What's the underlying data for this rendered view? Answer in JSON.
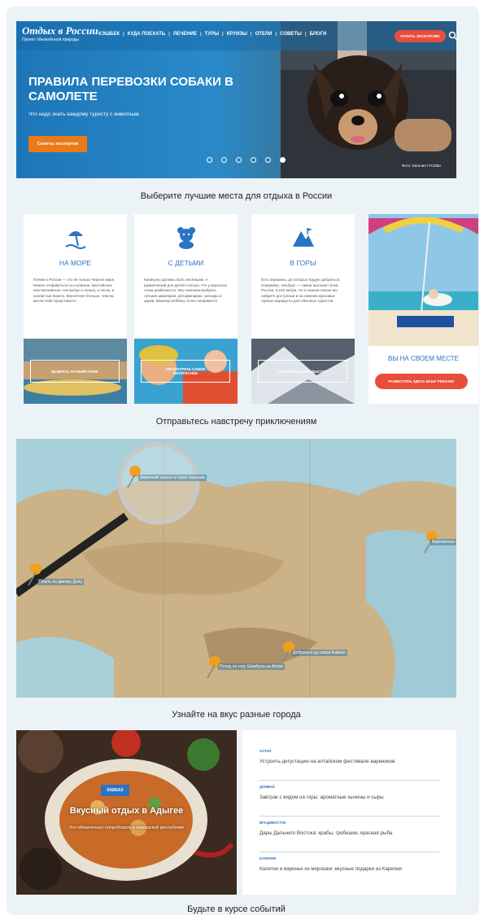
{
  "header": {
    "logo_title": "Отдых в России",
    "logo_subtitle": "Проект обновлённой природы",
    "nav": [
      "КЭШБЕК",
      "КУДА ПОЕХАТЬ",
      "ЛЕЧЕНИЕ",
      "ТУРЫ",
      "КРУИЗЫ",
      "ОТЕЛИ",
      "СОВЕТЫ",
      "БЛОГИ"
    ],
    "cta": "КУПИТЬ ЭКСКУРСИЮ",
    "search_icon": "search-icon"
  },
  "hero": {
    "title": "ПРАВИЛА ПЕРЕВОЗКИ СОБАКИ В САМОЛЕТЕ",
    "subtitle": "Что надо знать каждому туристу с животным",
    "button": "Советы экспертов",
    "slides": 6,
    "active_slide": 6,
    "credit": "Фото: Евгения ГУСЕВА"
  },
  "places": {
    "heading": "Выберите лучшие места для отдыха в России",
    "cards": [
      {
        "icon": "beach-umbrella-icon",
        "title": "НА МОРЕ",
        "text": "Пляжи в России — это не только Черное море. Можно отправиться на Азовское, Балтийское или Каспийское. На выбор и галька, и песок, и скалистые берега. Вероятнее больше, чем вы могли себе представить!",
        "button": "ВЫБРАТЬ ЛУЧШИЙ ПЛЯЖ"
      },
      {
        "icon": "teddy-bear-icon",
        "title": "С ДЕТЬМИ",
        "text": "Каникулы должны быть весёлыми. А развлечений для детей столько, что у взрослых глаза разбегаются. Мы поможем выбрать лучшие аквапарки, дельфинарии, зоосады и цирки. Вашему ребёнку точно понравится.",
        "button": "ПОСМОТРЕТЬ САМОЕ ИНТЕРЕСНОЕ"
      },
      {
        "icon": "mountain-icon",
        "title": "В ГОРЫ",
        "text": "Есть вершины, до которых трудно добраться. Например, Эльбрус — самая высокая точка России, 5 642 метра. Но в нашем списке вы найдете доступные и на нижнем красивые горные маршруты для обычных туристов.",
        "button": "ПОКОРИТЬ СВОЮ ВЫСОТУ"
      },
      {
        "title": "ВЫ НА СВОЕМ МЕСТЕ",
        "button": "РАЗМЕСТИТЬ ЗДЕСЬ ВАШУ РЕКЛАМУ"
      }
    ]
  },
  "adventures": {
    "heading": "Отправьтесь навстречу приключениям",
    "pins": [
      "Земляной каньон в горах Карелии",
      "Вертолетом к вулкану",
      "Плыть по дикому Дону",
      "Поход на гору Шамбала на Алтае",
      "Добраться до озера Байкал"
    ]
  },
  "cities": {
    "heading": "Узнайте на вкус разные города",
    "badge": "КАВКАЗ",
    "feature_title": "Вкусный отдых в Адыгее",
    "feature_subtitle": "Что обязательно попробовать в кавказской республике",
    "items": [
      {
        "region": "АЛТАЙ",
        "text": "Устроить дегустацию на алтайском фестивале вареников"
      },
      {
        "region": "ДОМБАЙ",
        "text": "Завтрак с видом на горы: ароматные хычины и сыры"
      },
      {
        "region": "ВЛАДИВОСТОК",
        "text": "Дары Дальнего Востока: крабы, гребешки, красная рыба"
      },
      {
        "region": "КАРЕЛИЯ",
        "text": "Калитки и варенье из морошки: вкусные подарки из Карелии"
      }
    ]
  },
  "events": {
    "heading": "Будьте в курсе событий"
  }
}
